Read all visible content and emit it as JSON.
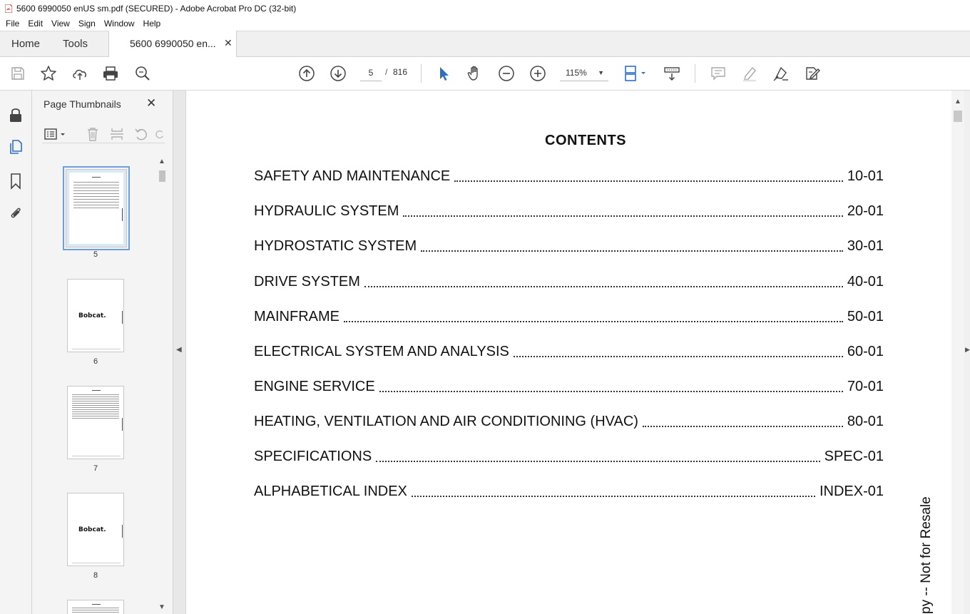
{
  "window": {
    "title": "5600 6990050 enUS sm.pdf (SECURED) - Adobe Acrobat Pro DC (32-bit)"
  },
  "menu": {
    "items": [
      "File",
      "Edit",
      "View",
      "Sign",
      "Window",
      "Help"
    ]
  },
  "tabs": {
    "home": "Home",
    "tools": "Tools",
    "document": "5600 6990050 en...",
    "close_glyph": "✕"
  },
  "toolbar": {
    "current_page": "5",
    "separator": "/",
    "total_pages": "816",
    "zoom": "115%",
    "zoom_arrow": "▼"
  },
  "thumbnails_panel": {
    "title": "Page Thumbnails",
    "close_glyph": "✕",
    "items": [
      {
        "page": "5",
        "selected": true
      },
      {
        "page": "6",
        "logo": "Bobcat."
      },
      {
        "page": "7"
      },
      {
        "page": "8",
        "logo": "Bobcat."
      }
    ]
  },
  "document": {
    "heading": "CONTENTS",
    "toc": [
      {
        "title": "SAFETY AND MAINTENANCE",
        "page": "10-01"
      },
      {
        "title": "HYDRAULIC SYSTEM",
        "page": "20-01"
      },
      {
        "title": "HYDROSTATIC SYSTEM",
        "page": "30-01"
      },
      {
        "title": "DRIVE SYSTEM",
        "page": "40-01"
      },
      {
        "title": "MAINFRAME",
        "page": "50-01"
      },
      {
        "title": "ELECTRICAL SYSTEM AND ANALYSIS",
        "page": "60-01"
      },
      {
        "title": "ENGINE SERVICE",
        "page": "70-01"
      },
      {
        "title": "HEATING, VENTILATION AND AIR CONDITIONING (HVAC)",
        "page": "80-01"
      },
      {
        "title": "SPECIFICATIONS",
        "page": "SPEC-01"
      },
      {
        "title": "ALPHABETICAL INDEX",
        "page": "INDEX-01"
      }
    ],
    "watermark": "py -- Not for Resale"
  },
  "colors": {
    "accent_blue": "#2d6fc4",
    "panel_bg": "#f4f4f4",
    "tab_bar_bg": "#f0f0f0",
    "pdf_icon_red": "#d32f2f"
  }
}
